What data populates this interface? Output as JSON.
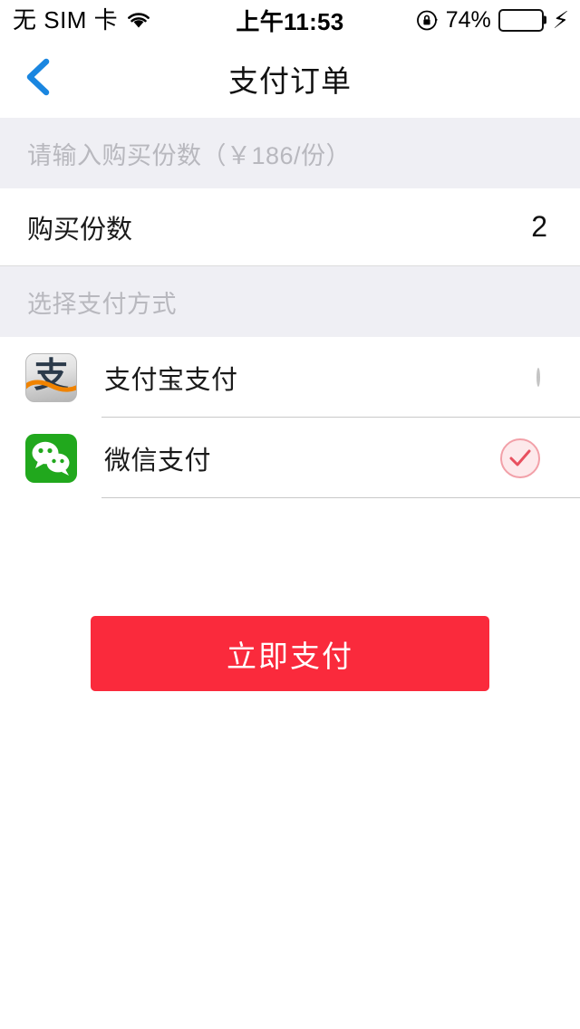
{
  "status_bar": {
    "carrier": "无 SIM 卡",
    "wifi_icon": "wifi-icon",
    "time": "上午11:53",
    "rotation_lock_icon": "rotation-lock-icon",
    "battery_percent": "74%",
    "battery_level": 74,
    "charging_icon": "lightning-bolt-icon"
  },
  "nav": {
    "back_icon": "chevron-left-icon",
    "title": "支付订单",
    "accent_color": "#1A86E0"
  },
  "quantity_section": {
    "header": "请输入购买份数（￥186/份）",
    "unit_price": "￥186/份",
    "row_label": "购买份数",
    "row_value": "2"
  },
  "payment_section": {
    "header": "选择支付方式",
    "methods": [
      {
        "name": "支付宝支付",
        "icon": "alipay-icon",
        "icon_glyph": "支",
        "selected": false,
        "radio_icon": "radio-unselected-icon"
      },
      {
        "name": "微信支付",
        "icon": "wechat-icon",
        "selected": true,
        "radio_icon": "radio-selected-check-icon"
      }
    ]
  },
  "action": {
    "pay_button_label": "立即支付",
    "pay_button_color": "#FA2A3C"
  },
  "colors": {
    "section_bg": "#EFEFF4",
    "section_text": "#B8B8BE",
    "wechat_green": "#21A81D",
    "selected_pink_border": "#F2A0A8",
    "selected_pink_fill": "#FDE9EB",
    "check_red": "#E8505F"
  }
}
